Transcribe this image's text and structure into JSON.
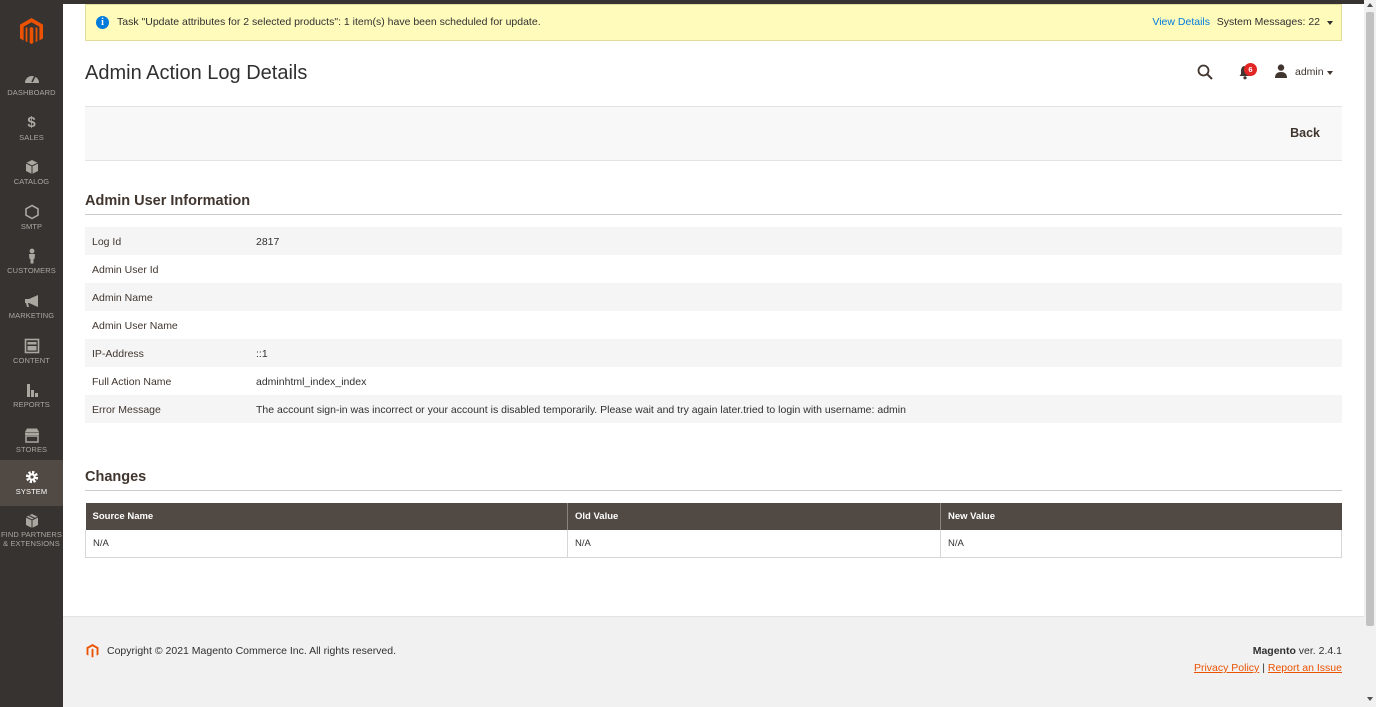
{
  "sidebar": {
    "items": [
      {
        "label": "DASHBOARD",
        "icon": "dashboard-icon"
      },
      {
        "label": "SALES",
        "icon": "dollar-icon"
      },
      {
        "label": "CATALOG",
        "icon": "cube-icon"
      },
      {
        "label": "SMTP",
        "icon": "hexagon-icon"
      },
      {
        "label": "CUSTOMERS",
        "icon": "person-icon"
      },
      {
        "label": "MARKETING",
        "icon": "megaphone-icon"
      },
      {
        "label": "CONTENT",
        "icon": "layout-icon"
      },
      {
        "label": "REPORTS",
        "icon": "bar-chart-icon"
      },
      {
        "label": "STORES",
        "icon": "storefront-icon"
      },
      {
        "label": "SYSTEM",
        "icon": "gear-icon",
        "active": true
      },
      {
        "label": "FIND PARTNERS & EXTENSIONS",
        "label_line1": "FIND PARTNERS",
        "label_line2": "& EXTENSIONS",
        "icon": "box-icon"
      }
    ]
  },
  "system_message": {
    "text": "Task \"Update attributes for 2 selected products\": 1 item(s) have been scheduled for update.",
    "view_details": "View Details",
    "count_label": "System Messages: 22"
  },
  "header": {
    "title": "Admin Action Log Details",
    "notifications_count": "6",
    "user": "admin"
  },
  "actions": {
    "back": "Back"
  },
  "user_info": {
    "title": "Admin User Information",
    "rows": [
      {
        "label": "Log Id",
        "value": "2817"
      },
      {
        "label": "Admin User Id",
        "value": ""
      },
      {
        "label": "Admin Name",
        "value": ""
      },
      {
        "label": "Admin User Name",
        "value": ""
      },
      {
        "label": "IP-Address",
        "value": "::1"
      },
      {
        "label": "Full Action Name",
        "value": "adminhtml_index_index"
      },
      {
        "label": "Error Message",
        "value": "The account sign-in was incorrect or your account is disabled temporarily. Please wait and try again later.tried to login with username: admin"
      }
    ]
  },
  "changes": {
    "title": "Changes",
    "columns": [
      "Source Name",
      "Old Value",
      "New Value"
    ],
    "rows": [
      [
        "N/A",
        "N/A",
        "N/A"
      ]
    ]
  },
  "footer": {
    "copyright": "Copyright © 2021 Magento Commerce Inc. All rights reserved.",
    "brand": "Magento",
    "version": " ver. 2.4.1",
    "privacy": "Privacy Policy",
    "separator": " | ",
    "report": "Report an Issue"
  },
  "colors": {
    "sidebar_bg": "#373330",
    "sidebar_active": "#514943",
    "accent": "#eb5202",
    "link": "#007bdb",
    "message_bg": "#fffbbb",
    "table_header": "#514943"
  }
}
